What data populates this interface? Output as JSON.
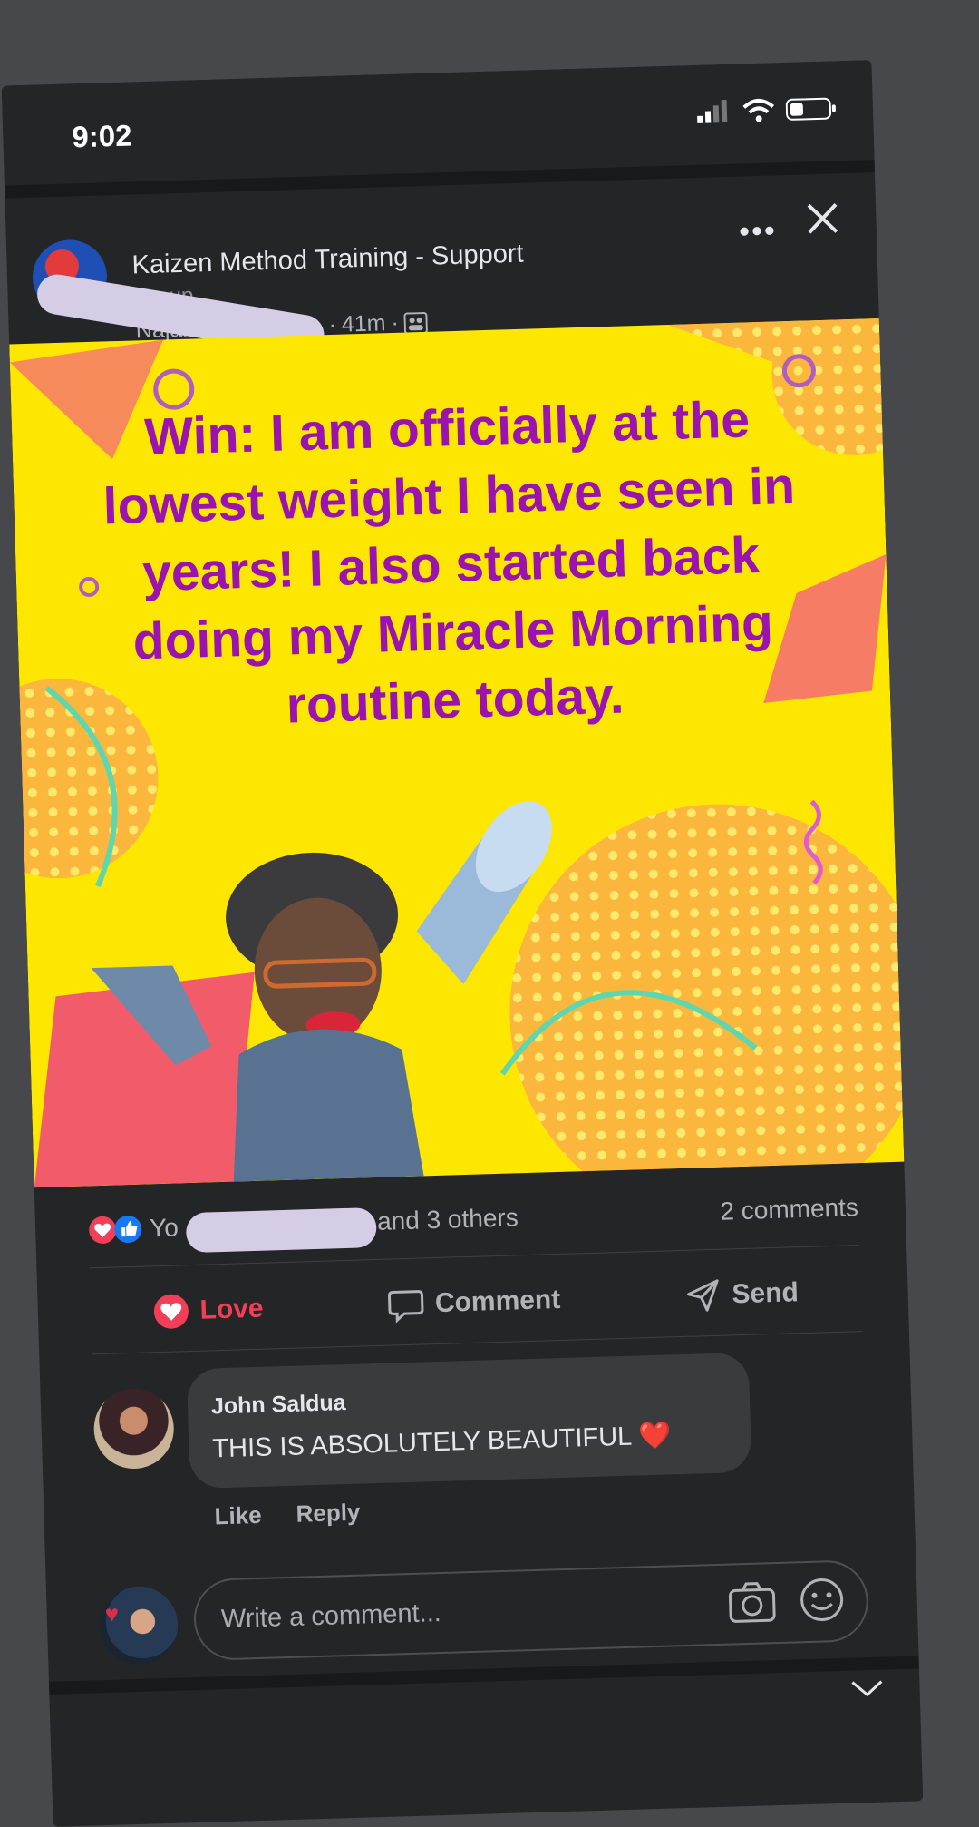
{
  "status_bar": {
    "time": "9:02"
  },
  "post": {
    "group_name": "Kaizen Method Training - Support",
    "group_name_cont": "Group",
    "author_partial": "Najala",
    "time_ago": "41m",
    "dot": "·",
    "image_text": "Win: I am officially at the lowest weight I have seen in years! I also started back doing my Miracle Morning routine today."
  },
  "reactions": {
    "names_prefix": "Yo",
    "others": "a and 3 others",
    "comments": "2 comments"
  },
  "actions": {
    "love": "Love",
    "comment": "Comment",
    "send": "Send"
  },
  "comment": {
    "author": "John Saldua",
    "text": "THIS IS ABSOLUTELY BEAUTIFUL ❤️",
    "like": "Like",
    "reply": "Reply"
  },
  "composer": {
    "placeholder": "Write a comment..."
  },
  "colors": {
    "background": "#242526",
    "accent_love": "#f33e58",
    "image_bg": "#fde700",
    "image_text": "#9a13b0"
  },
  "icons": [
    "signal-icon",
    "wifi-icon",
    "battery-icon",
    "more-icon",
    "close-icon",
    "group-icon",
    "heart-reaction-icon",
    "like-reaction-icon",
    "heart-icon",
    "comment-icon",
    "send-icon",
    "camera-icon",
    "emoji-icon",
    "chevron-down-icon"
  ]
}
